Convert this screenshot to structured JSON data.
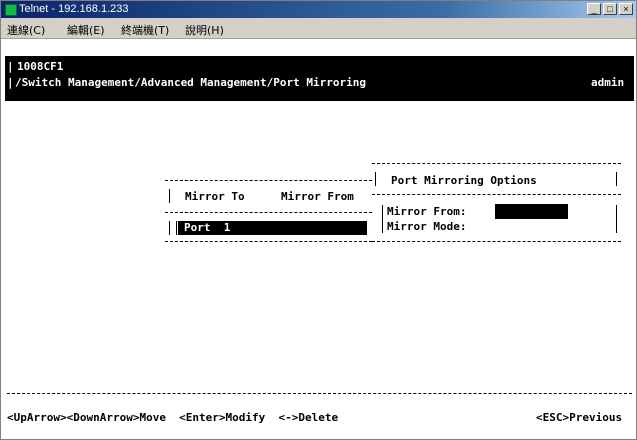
{
  "window": {
    "title": "Telnet - 192.168.1.233",
    "menu": [
      "連線(C)",
      "編輯(E)",
      "終端機(T)",
      "說明(H)"
    ],
    "buttons": [
      "_",
      "□",
      "×"
    ]
  },
  "terminal": {
    "device": "1008CF1",
    "path": "/Switch Management/Advanced Management/Port Mirroring",
    "user": "admin",
    "mirror_to_label": "Mirror To",
    "mirror_from_label": "Mirror From",
    "port_value": "Port  1",
    "options_title": "Port Mirroring Options",
    "mirror_from_field": "Mirror From:",
    "mirror_mode_field": "Mirror Mode:",
    "footer_left": "<UpArrow><DownArrow>Move  <Enter>Modify  <->Delete",
    "footer_right": "<ESC>Previous"
  }
}
